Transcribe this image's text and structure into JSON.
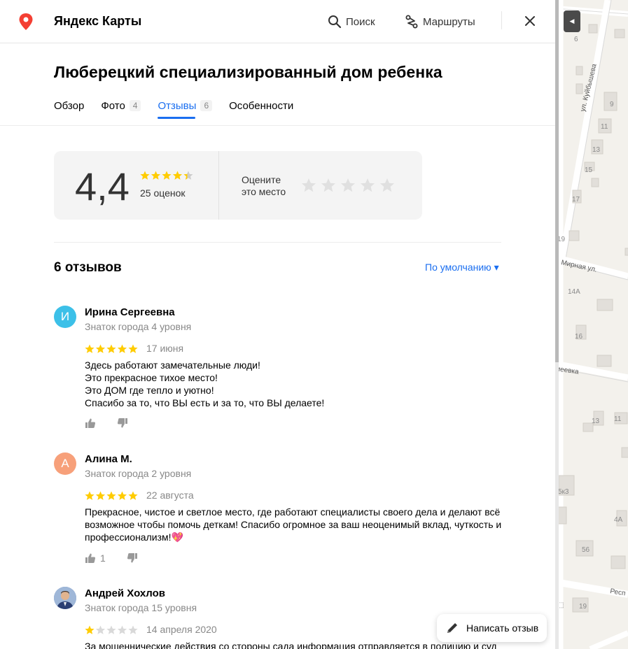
{
  "app": {
    "title": "Яндекс Карты",
    "search_label": "Поиск",
    "routes_label": "Маршруты",
    "brand_color": "#f43f33",
    "accent_color": "#1a6ef0"
  },
  "place": {
    "title": "Люберецкий специализированный дом ребенка"
  },
  "tabs": [
    {
      "label": "Обзор",
      "count": ""
    },
    {
      "label": "Фото",
      "count": "4"
    },
    {
      "label": "Отзывы",
      "count": "6"
    },
    {
      "label": "Особенности",
      "count": ""
    }
  ],
  "rating": {
    "value": "4,4",
    "stars_value": 4.4,
    "count_label": "25 оценок",
    "rate_prompt": "Оцените это место"
  },
  "reviews_header": {
    "count_label": "6 отзывов",
    "sort_label": "По умолчанию ▾"
  },
  "reviews": [
    {
      "initial": "И",
      "avatar_color": "#3cc0e8",
      "name": "Ирина Сергеевна",
      "level": "Знаток города 4 уровня",
      "stars": 5,
      "date": "17 июня",
      "text": [
        "Здесь работают замечательные люди!",
        "Это прекрасное тихое место!",
        "Это ДОМ где тепло и уютно!",
        "Спасибо за то, что ВЫ есть и за то, что ВЫ делаете!"
      ],
      "likes": ""
    },
    {
      "initial": "А",
      "avatar_color": "#f7a07a",
      "name": "Алина М.",
      "level": "Знаток города 2 уровня",
      "stars": 5,
      "date": "22 августа",
      "text": [
        "Прекрасное, чистое и светлое место, где работают специалисты своего дела и делают всё возможное чтобы помочь деткам! Спасибо огромное за ваш неоценимый вклад, чуткость и профессионализм!💖"
      ],
      "likes": "1"
    },
    {
      "initial": "",
      "avatar_color": "#6a8cc2",
      "name": "Андрей Хохлов",
      "level": "Знаток города 15 уровня",
      "stars": 1,
      "date": "14 апреля 2020",
      "text": [
        "За мошеннические действия со стороны сада информация отправляется в полицию и суд"
      ],
      "likes": ""
    }
  ],
  "write_review": {
    "label": "Написать отзыв"
  },
  "map": {
    "labels": [
      "ул. Куйбышева",
      "Мирная ул.",
      "меевка",
      "Респ",
      "6",
      "9",
      "11",
      "13",
      "15",
      "17",
      "19",
      "14А",
      "16",
      "13",
      "11",
      "5к3",
      "4А",
      "56",
      "19"
    ]
  }
}
